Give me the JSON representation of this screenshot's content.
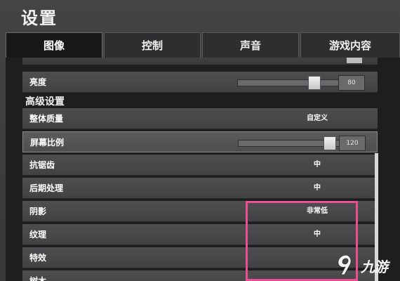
{
  "window": {
    "title": "设置"
  },
  "tabs": [
    {
      "label": "图像",
      "active": true
    },
    {
      "label": "控制",
      "active": false
    },
    {
      "label": "声音",
      "active": false
    },
    {
      "label": "游戏内容",
      "active": false
    }
  ],
  "settings": {
    "brightness": {
      "label": "亮度",
      "value": "80",
      "level_percent": 77
    },
    "advanced_header": "高级设置",
    "overall_quality": {
      "label": "整体质量",
      "value": "自定义"
    },
    "screen_scale": {
      "label": "屏幕比例",
      "value": "120",
      "level_percent": 93
    },
    "anti_aliasing": {
      "label": "抗锯齿",
      "value": "中"
    },
    "post_processing": {
      "label": "后期处理",
      "value": "中"
    },
    "shadows": {
      "label": "阴影",
      "value": "非常低"
    },
    "textures": {
      "label": "纹理",
      "value": "中"
    },
    "effects": {
      "label": "特效",
      "value": ""
    },
    "foliage": {
      "label": "树木",
      "value": ""
    }
  },
  "annotation": {
    "highlight_color": "#e8508f"
  },
  "watermark": {
    "text": "九游",
    "icon": "jiuyou-logo-icon"
  },
  "colors": {
    "panel": "#1e1e20",
    "row": "#4a4a4c",
    "accent": "#e8508f"
  }
}
